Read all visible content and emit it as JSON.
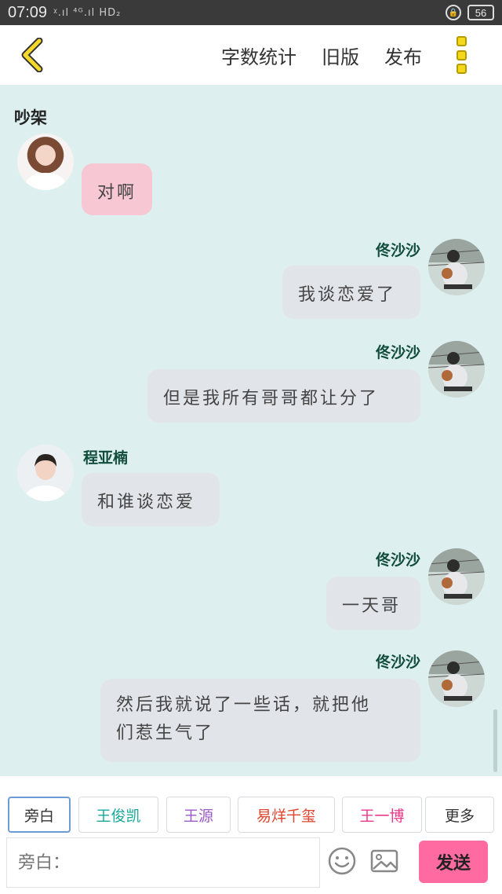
{
  "status_bar": {
    "time": "07:09",
    "signal_text": "ᵡ.ıl ⁴ᴳ.ıl HD₂",
    "battery": "56"
  },
  "top_bar": {
    "word_count_label": "字数统计",
    "old_version_label": "旧版",
    "publish_label": "发布"
  },
  "chat": {
    "title": "吵架",
    "messages": [
      {
        "side": "left",
        "sender": "",
        "text": "对啊",
        "style": "pink"
      },
      {
        "side": "right",
        "sender": "佟沙沙",
        "text": "我谈恋爱了"
      },
      {
        "side": "right",
        "sender": "佟沙沙",
        "text": "但是我所有哥哥都让分了"
      },
      {
        "side": "left",
        "sender": "程亚楠",
        "text": "和谁谈恋爱"
      },
      {
        "side": "right",
        "sender": "佟沙沙",
        "text": "一天哥"
      },
      {
        "side": "right",
        "sender": "佟沙沙",
        "text_line1": "然后我就说了一些话，就把他",
        "text_line2": "们惹生气了"
      }
    ]
  },
  "character_chips": [
    {
      "label": "旁白",
      "color": "#333333"
    },
    {
      "label": "王俊凯",
      "color": "#1aa89a"
    },
    {
      "label": "王源",
      "color": "#9b59c9"
    },
    {
      "label": "易烊千玺",
      "color": "#e0442e"
    },
    {
      "label": "王一博",
      "color": "#e8398a"
    },
    {
      "label": "更多",
      "color": "#333333"
    }
  ],
  "composer": {
    "placeholder": "旁白：",
    "send_label": "发送"
  },
  "colors": {
    "background": "#ddf0ef",
    "send_button": "#ff6aa0",
    "sender_name": "#114c3c",
    "bubble": "#e1e5ea",
    "bubble_pink": "#f7c7d4"
  }
}
